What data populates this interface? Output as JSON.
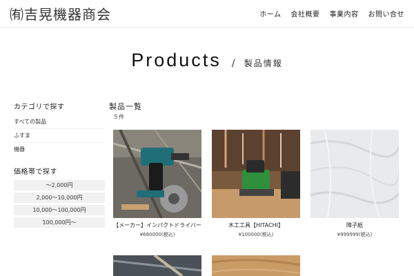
{
  "header": {
    "logo": "㈲吉晃機器商会",
    "nav": [
      "ホーム",
      "会社概要",
      "事業内容",
      "お問い合せ"
    ]
  },
  "hero": {
    "title": "Products",
    "slash": "/",
    "subtitle": "製品情報"
  },
  "sidebar": {
    "category_heading": "カテゴリで探す",
    "categories": [
      "すべての製品",
      "ふすま",
      "機器"
    ],
    "price_heading": "価格帯で探す",
    "price_ranges": [
      "〜2,000円",
      "2,000〜10,000円",
      "10,000〜100,000円",
      "100,000円〜"
    ]
  },
  "main": {
    "list_title": "製品一覧",
    "count": "５件",
    "products": [
      {
        "name": "【メーカー】インパクトドライバー",
        "price": "¥680000(税込)"
      },
      {
        "name": "木工工具【HITACHI】",
        "price": "¥100000(税込)"
      },
      {
        "name": "障子紙",
        "price": "¥999999(税込)"
      }
    ]
  }
}
